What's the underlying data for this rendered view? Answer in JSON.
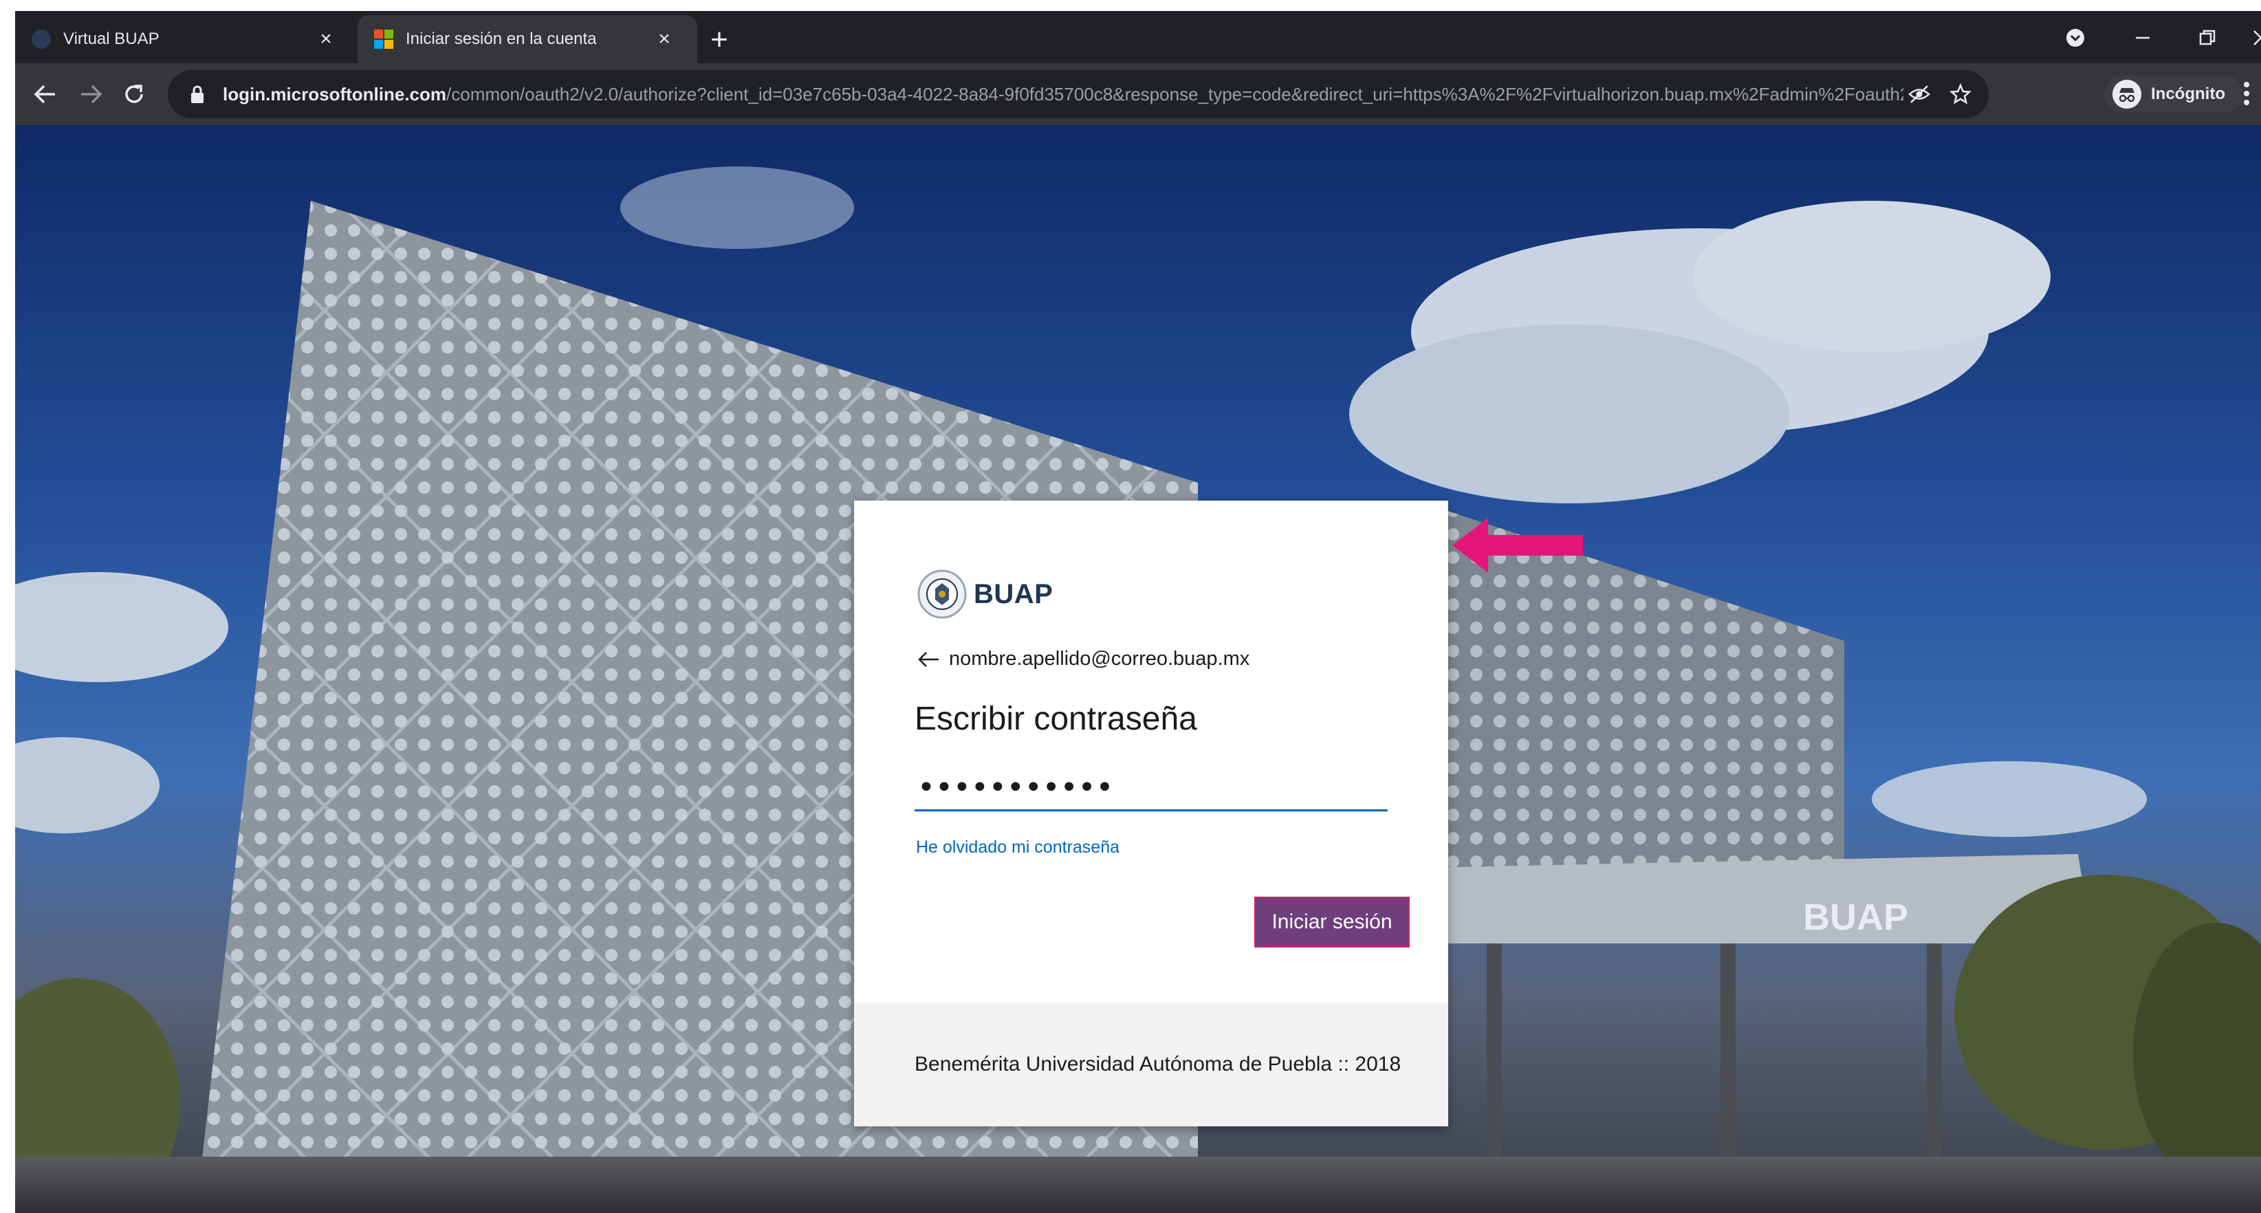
{
  "browser": {
    "tabs": [
      {
        "title": "Virtual BUAP",
        "active": false
      },
      {
        "title": "Iniciar sesión en la cuenta",
        "active": true
      }
    ],
    "new_tab_glyph": "+",
    "close_glyph": "×",
    "address_bar": {
      "host": "login.microsoftonline.com",
      "path": "/common/oauth2/v2.0/authorize?client_id=03e7c65b-03a4-4022-8a84-9f0fd35700c8&response_type=code&redirect_uri=https%3A%2F%2Fvirtualhorizon.buap.mx%2Fadmin%2Foauth2c..."
    },
    "profile_label": "Incógnito",
    "colors": {
      "tab_bar": "#202124",
      "toolbar": "#35363a"
    }
  },
  "login": {
    "brand": "BUAP",
    "identity_email": "nombre.apellido@correo.buap.mx",
    "title": "Escribir contraseña",
    "password_value": "•••••••••••",
    "forgot_password": "He olvidado mi contraseña",
    "signin_button": "Iniciar sesión",
    "footer": "Benemérita Universidad Autónoma de Puebla :: 2018",
    "colors": {
      "button_bg": "#6f3f7d",
      "button_border": "#d3215f",
      "link": "#0067b8",
      "annotation_arrow": "#e6157a"
    }
  },
  "background_sign": "BUAP"
}
